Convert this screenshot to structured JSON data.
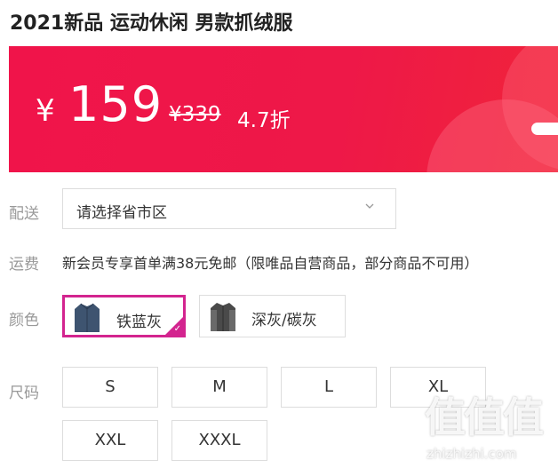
{
  "product": {
    "title": "2021新品 运动休闲 男款抓绒服"
  },
  "price": {
    "currency": "¥",
    "current": "159",
    "original": "¥339",
    "discount": "4.7折"
  },
  "delivery": {
    "label": "配送",
    "placeholder": "请选择省市区"
  },
  "shipping": {
    "label": "运费",
    "text": "新会员专享首单满38元免邮（限唯品自营商品，部分商品不可用）"
  },
  "colors": {
    "label": "颜色",
    "options": [
      {
        "name": "铁蓝灰",
        "selected": true,
        "swatch": "#3e5470"
      },
      {
        "name": "深灰/碳灰",
        "selected": false,
        "swatch": "#4a4a4a"
      }
    ]
  },
  "sizes": {
    "label": "尺码",
    "options": [
      "S",
      "M",
      "L",
      "XL",
      "XXL",
      "XXXL"
    ]
  },
  "watermark": {
    "glyphs": "值值值",
    "site": "zhizhizhi.com"
  },
  "theme": {
    "accent": "#f0144a",
    "selected_border": "#d3248f"
  }
}
